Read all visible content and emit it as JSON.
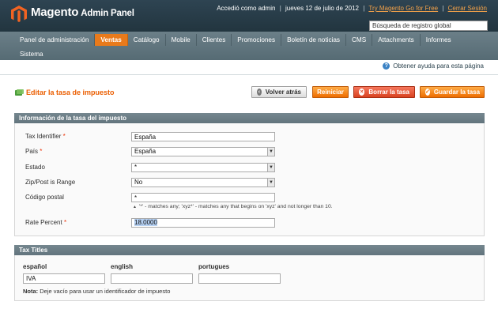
{
  "header": {
    "brand": "Magento",
    "brand_suffix": "Admin Panel",
    "login_text": "Accedió como admin",
    "date": "jueves 12 de julio de 2012",
    "try_link": "Try Magento Go for Free",
    "logout_link": "Cerrar Sesión",
    "search_value": "Búsqueda de registro global"
  },
  "nav": {
    "items": [
      {
        "label": "Panel de administración"
      },
      {
        "label": "Ventas"
      },
      {
        "label": "Catálogo"
      },
      {
        "label": "Mobile"
      },
      {
        "label": "Clientes"
      },
      {
        "label": "Promociones"
      },
      {
        "label": "Boletín de noticias"
      },
      {
        "label": "CMS"
      },
      {
        "label": "Attachments"
      },
      {
        "label": "Informes"
      },
      {
        "label": "Sistema"
      }
    ],
    "active_index": 1
  },
  "help": {
    "label": "Obtener ayuda para esta página"
  },
  "page": {
    "title": "Editar la tasa de impuesto",
    "buttons": {
      "back": "Volver atrás",
      "reset": "Reiniciar",
      "delete": "Borrar la tasa",
      "save": "Guardar la tasa"
    }
  },
  "rate_info": {
    "section_title": "Información de la tasa del impuesto",
    "fields": {
      "tax_identifier": {
        "label": "Tax Identifier",
        "value": "España"
      },
      "country": {
        "label": "País",
        "value": "España"
      },
      "state": {
        "label": "Estado",
        "value": "*"
      },
      "zip_range": {
        "label": "Zip/Post is Range",
        "value": "No"
      },
      "postcode": {
        "label": "Código postal",
        "value": "*"
      },
      "rate": {
        "label": "Rate Percent",
        "value": "18.0000"
      }
    },
    "postcode_note": "'*' - matches any; 'xyz*' - matches any that begins on 'xyz' and not longer than 10."
  },
  "tax_titles": {
    "section_title": "Tax Titles",
    "columns": [
      {
        "label": "español",
        "value": "IVA"
      },
      {
        "label": "english",
        "value": ""
      },
      {
        "label": "portugues",
        "value": ""
      }
    ],
    "note_label": "Nota:",
    "note_text": "Deje vacío para usar un identificador de impuesto"
  },
  "colors": {
    "accent": "#eb5e00",
    "header_bg": "#2e4452",
    "nav_bg": "#62747d",
    "link": "#f3a24a",
    "delete": "#d84220"
  }
}
